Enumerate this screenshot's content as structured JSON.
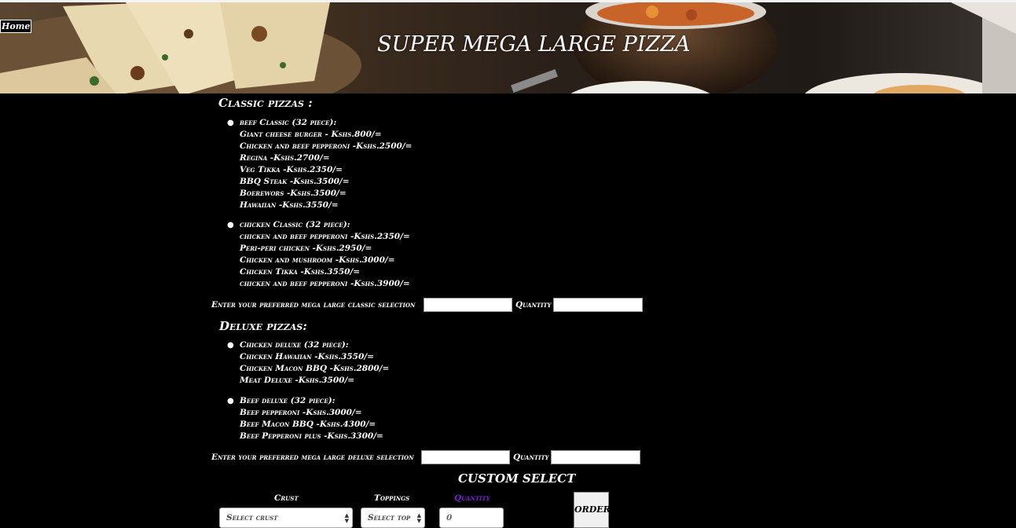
{
  "nav": {
    "home_label": "Home"
  },
  "header": {
    "title": "SUPER MEGA LARGE PIZZA"
  },
  "classic": {
    "heading": "Classic pizzas :",
    "groups": [
      {
        "title": "beef Classic (32 piece):",
        "items": [
          "Giant cheese burger - Kshs.800/=",
          "Chicken and beef pepperoni -Kshs.2500/=",
          "Regina -Kshs.2700/=",
          "Veg Tikka -Kshs.2350/=",
          "BBQ Steak -Kshs.3500/=",
          "Boerewors -Kshs.3500/=",
          "Hawaiian -Kshs.3550/="
        ]
      },
      {
        "title": "chicken Classic (32 piece):",
        "items": [
          "chicken and beef pepperoni -Kshs.2350/=",
          "Peri-peri chicken -Kshs.2950/=",
          "Chicken and mushroom -Kshs.3000/=",
          "Chicken Tikka -Kshs.3550/=",
          "chicken and beef pepperoni -Kshs.3900/="
        ]
      }
    ],
    "entry_label": "Enter your preferred mega large classic selection",
    "quantity_label": "Quantity"
  },
  "deluxe": {
    "heading": "Deluxe pizzas:",
    "groups": [
      {
        "title": "Chicken deluxe (32 piece):",
        "items": [
          "Chicken Hawaiian -Kshs.3550/=",
          "Chicken Macon BBQ -Kshs.2800/=",
          "Meat Deluxe -Kshs.3500/="
        ]
      },
      {
        "title": "Beef deluxe (32 piece):",
        "items": [
          "Beef pepperoni -Kshs.3000/=",
          "Beef Macon BBQ -Kshs.4300/=",
          "Beef Pepperoni plus -Kshs.3300/="
        ]
      }
    ],
    "entry_label": "Enter your preferred mega large deluxe selection",
    "quantity_label": "Quantity"
  },
  "custom": {
    "heading": "CUSTOM SELECT",
    "crust_label": "Crust",
    "toppings_label": "Toppings",
    "quantity_label": "Quantity",
    "crust_selected": "Select crust",
    "toppings_selected": "Select top",
    "quantity_value": "0",
    "order_label": "ORDER",
    "quantity_label_color": "#7b1fd6"
  },
  "icons": {
    "select_arrows": "select-arrows-icon",
    "bullet": "bullet-icon"
  }
}
